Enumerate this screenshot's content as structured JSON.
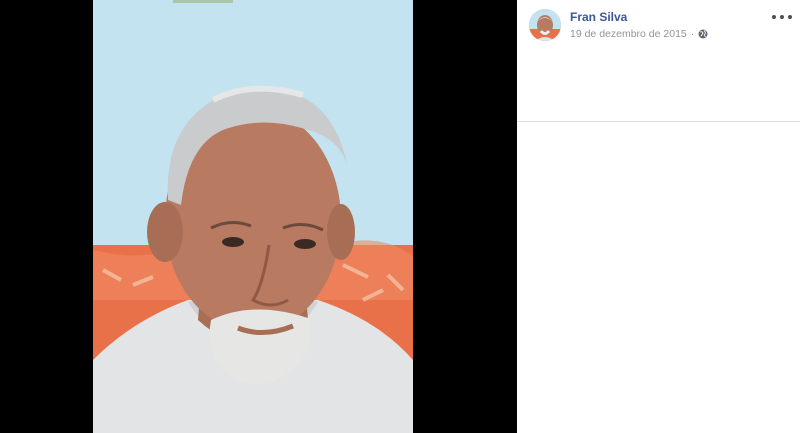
{
  "post": {
    "author_name": "Fran Silva",
    "date": "19 de dezembro de 2015",
    "separator": "·",
    "privacy_icon": "globe-icon",
    "more_icon": "more-options-icon"
  },
  "colors": {
    "author_link": "#385898",
    "meta_text": "#90949c",
    "viewer_background": "#000000",
    "panel_background": "#ffffff"
  }
}
